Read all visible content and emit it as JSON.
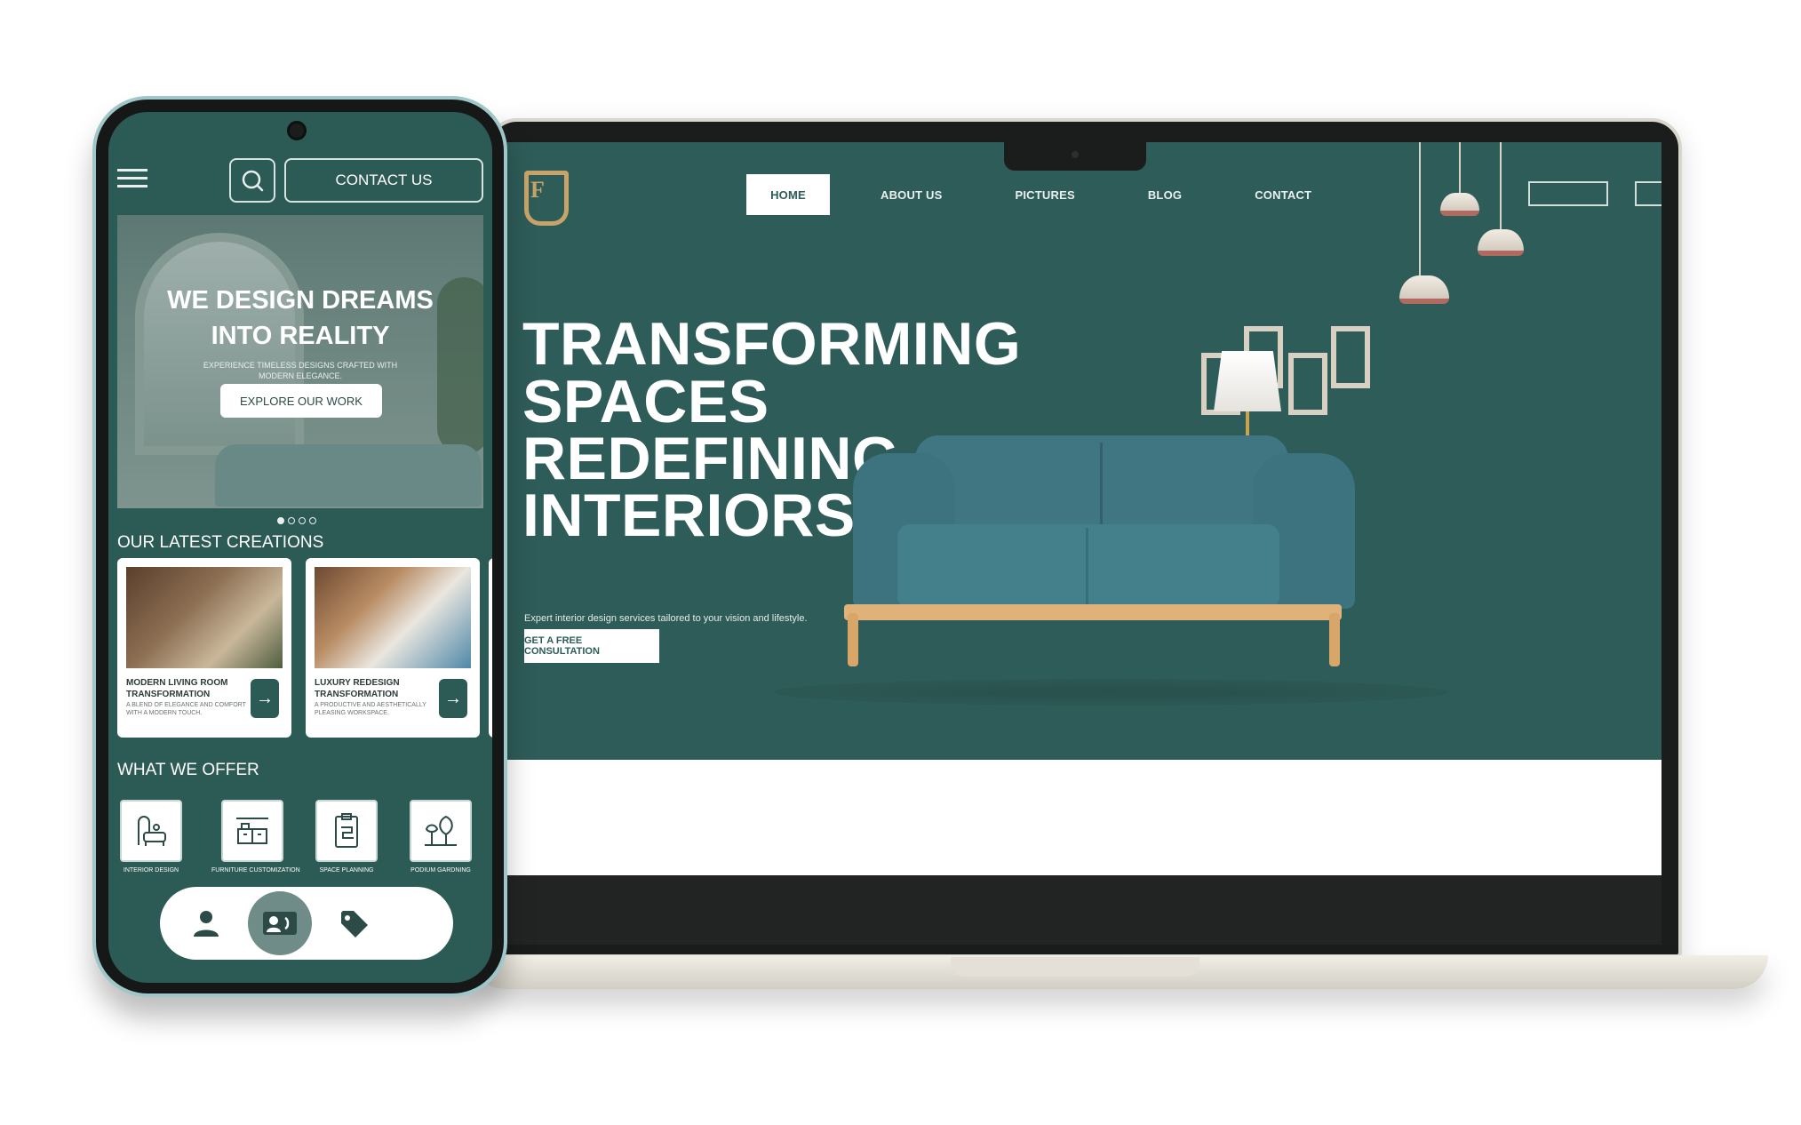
{
  "desktop": {
    "logo_text": "F",
    "nav": [
      "HOME",
      "ABOUT US",
      "PICTURES",
      "BLOG",
      "CONTACT"
    ],
    "active_nav": "HOME",
    "hero": {
      "lines": [
        "TRANSFORMING",
        "SPACES",
        "REDEFINING",
        "INTERIORS"
      ],
      "subtitle": "Expert interior design services tailored to your vision and lifestyle.",
      "cta": "GET A FREE CONSULTATION"
    }
  },
  "mobile": {
    "contact_label": "CONTACT US",
    "banner": {
      "title_line1": "WE DESIGN DREAMS",
      "title_line2": "INTO REALITY",
      "subtitle": "EXPERIENCE TIMELESS DESIGNS CRAFTED WITH MODERN ELEGANCE.",
      "cta": "EXPLORE OUR WORK",
      "slides": 4,
      "active_slide": 1
    },
    "creations_title": "OUR LATEST CREATIONS",
    "creations": [
      {
        "title": "MODERN LIVING ROOM TRANSFORMATION",
        "desc": "A BLEND OF ELEGANCE AND COMFORT WITH A MODERN TOUCH."
      },
      {
        "title": "LUXURY REDESIGN TRANSFORMATION",
        "desc": "A PRODUCTIVE AND AESTHETICALLY PLEASING WORKSPACE."
      }
    ],
    "offer_title": "WHAT WE OFFER",
    "services": [
      {
        "label": "INTERIOR DESIGN",
        "icon": "interior-design-icon"
      },
      {
        "label": "FURNITURE CUSTOMIZATION",
        "icon": "furniture-icon"
      },
      {
        "label": "SPACE PLANNING",
        "icon": "space-planning-icon"
      },
      {
        "label": "PODIUM GARDNING",
        "icon": "garden-icon"
      }
    ],
    "bottom_nav": [
      {
        "icon": "person-icon",
        "active": false
      },
      {
        "icon": "contact-card-icon",
        "active": true
      },
      {
        "icon": "tag-icon",
        "active": false
      }
    ],
    "colors": {
      "primary": "#2c5a55",
      "accent": "#c8a46a",
      "surface": "#ffffff"
    }
  }
}
